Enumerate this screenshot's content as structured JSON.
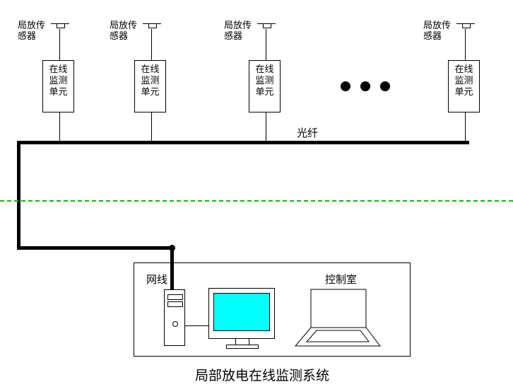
{
  "sensor_label": "局放传\n感器",
  "unit_label": "在线\n监测\n单元",
  "fiber_label": "光纤",
  "net_label": "网线",
  "room_label": "控制室",
  "title": "局部放电在线监测系统"
}
